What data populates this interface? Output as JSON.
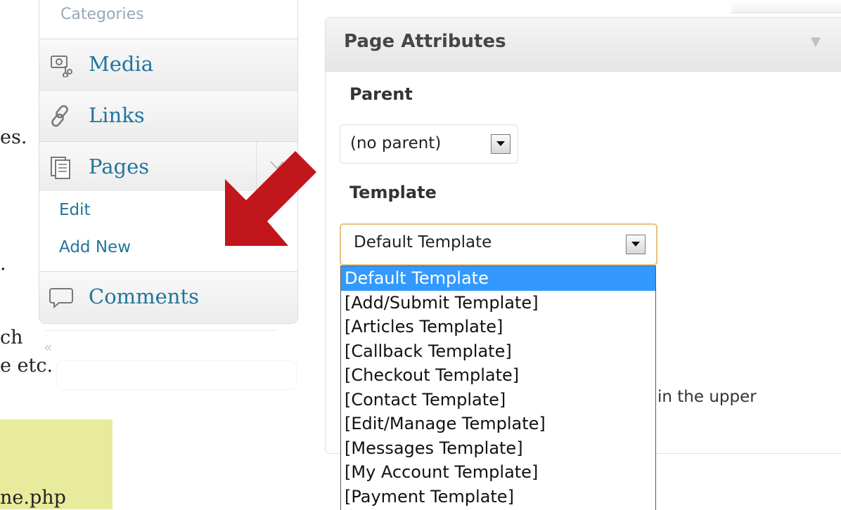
{
  "background": {
    "fragments": [
      "es.",
      ".",
      "ch",
      "e etc.",
      "ne.php"
    ]
  },
  "menu": {
    "top_sub_item": "Categories",
    "items": [
      {
        "label": "Media",
        "icon": "media-icon"
      },
      {
        "label": "Links",
        "icon": "links-icon"
      },
      {
        "label": "Pages",
        "icon": "pages-icon"
      },
      {
        "label": "Comments",
        "icon": "comments-icon"
      }
    ],
    "pages_submenu": [
      "Edit",
      "Add New"
    ],
    "collapse_glyph": "«"
  },
  "panel": {
    "title": "Page Attributes",
    "parent_label": "Parent",
    "parent_value": "(no parent)",
    "template_label": "Template",
    "template_value": "Default Template",
    "tail_text": "in the upper"
  },
  "template_options": [
    "Default Template",
    "[Add/Submit Template]",
    "[Articles Template]",
    "[Callback Template]",
    "[Checkout Template]",
    "[Contact Template]",
    "[Edit/Manage Template]",
    "[Messages Template]",
    "[My Account Template]",
    "[Payment Template]"
  ],
  "colors": {
    "link": "#21759b",
    "selected_option": "#3399ff",
    "arrow": "#c1161c",
    "note_box": "#e8eb9c",
    "focus_border": "#e8c27a"
  }
}
